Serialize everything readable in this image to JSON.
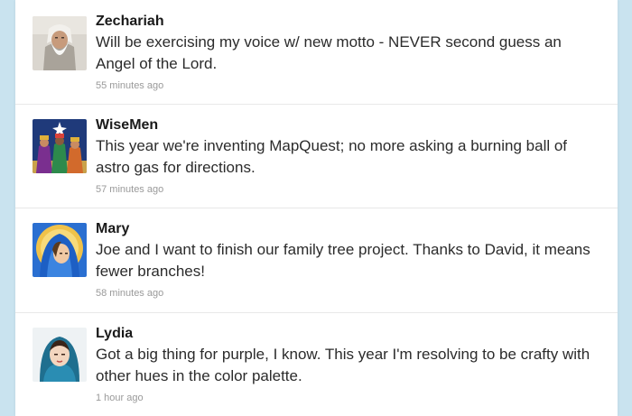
{
  "tweets": [
    {
      "user": "Zechariah",
      "text": "Will be exercising my voice w/ new motto - NEVER second guess an Angel of the Lord.",
      "time": "55 minutes ago",
      "avatar_icon": "bearded-elder-icon"
    },
    {
      "user": "WiseMen",
      "text": "This year we're inventing MapQuest; no more asking a burning ball of astro gas for directions.",
      "time": "57 minutes ago",
      "avatar_icon": "three-wise-men-icon"
    },
    {
      "user": "Mary",
      "text": "Joe and I want to finish our family tree project. Thanks to David, it means fewer branches!",
      "time": "58 minutes ago",
      "avatar_icon": "veiled-woman-icon"
    },
    {
      "user": "Lydia",
      "text": "Got a big thing for purple, I know. This year I'm resolving to be crafty with other hues in the color palette.",
      "time": "1 hour ago",
      "avatar_icon": "woman-headscarf-icon"
    }
  ],
  "colors": {
    "page_background": "#c9e3ef",
    "card_background": "#ffffff",
    "divider": "#e8e8e8",
    "timestamp": "#9a9a9a"
  }
}
